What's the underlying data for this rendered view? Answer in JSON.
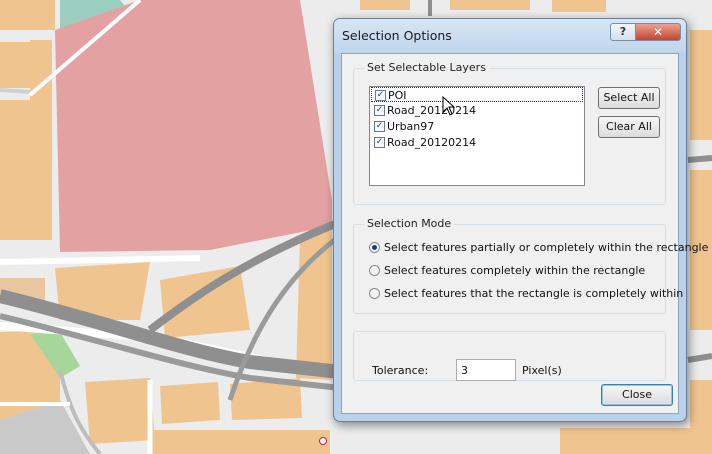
{
  "dialog": {
    "title": "Selection Options",
    "help_label": "?",
    "close_symbol": "✕"
  },
  "layers_group": {
    "legend": "Set Selectable Layers",
    "layers": [
      {
        "name": "POI",
        "checked": true,
        "selected": true
      },
      {
        "name": "Road_20120214",
        "checked": true,
        "selected": false
      },
      {
        "name": "Urban97",
        "checked": true,
        "selected": false
      },
      {
        "name": "Road_20120214",
        "checked": true,
        "selected": false
      }
    ],
    "select_all_label": "Select All",
    "clear_all_label": "Clear All"
  },
  "mode_group": {
    "legend": "Selection Mode",
    "options": [
      {
        "label": "Select features partially or completely within the rectangle",
        "checked": true
      },
      {
        "label": "Select features completely within the rectangle",
        "checked": false
      },
      {
        "label": "Select features that the rectangle is completely within",
        "checked": false
      }
    ]
  },
  "tolerance": {
    "label": "Tolerance:",
    "value": "3",
    "unit": "Pixel(s)"
  },
  "footer": {
    "close_label": "Close"
  },
  "icons": {
    "check": "✓",
    "cursor": "arrow-cursor",
    "map_point": "poi-marker"
  },
  "colors": {
    "urban_fill": "#f0c48f",
    "poi_area": "#e4a1a1",
    "water": "#9ccdc1",
    "park": "#a7d69a",
    "road_casing": "#8f8f8f",
    "dialog_frame": "#b9d1ea",
    "close_button": "#c7422d"
  }
}
